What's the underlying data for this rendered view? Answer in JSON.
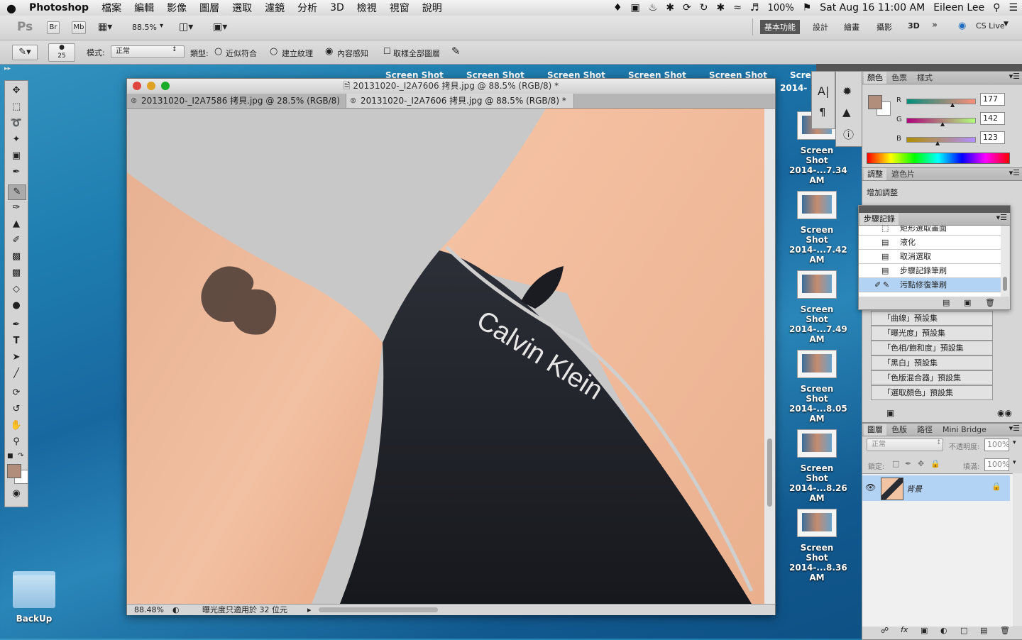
{
  "menubar": {
    "apple": "",
    "app": "Photoshop",
    "items": [
      "檔案",
      "編輯",
      "影像",
      "圖層",
      "選取",
      "濾鏡",
      "分析",
      "3D",
      "檢視",
      "視窗",
      "說明"
    ],
    "battery": "100%",
    "datetime": "Sat Aug 16  11:00 AM",
    "user": "Eileen Lee"
  },
  "appbar": {
    "ps": "Ps",
    "br": "Br",
    "mb": "Mb",
    "zoom": "88.5%",
    "workspaces": [
      "基本功能",
      "設計",
      "繪畫",
      "攝影",
      "3D"
    ],
    "active_workspace": "基本功能",
    "cslive": "CS Live"
  },
  "optbar": {
    "brush_size": "25",
    "mode_label": "模式:",
    "mode_value": "正常",
    "type_label": "類型:",
    "type_options": [
      "近似符合",
      "建立紋理",
      "內容感知"
    ],
    "selected_type": "內容感知",
    "sample_all": "取樣全部圖層"
  },
  "document": {
    "title": "20131020-_I2A7606 拷貝.jpg @ 88.5% (RGB/8) *",
    "tabs": [
      {
        "label": "20131020-_I2A7586 拷貝.jpg @ 28.5% (RGB/8)"
      },
      {
        "label": "20131020-_I2A7606 拷貝.jpg @ 88.5% (RGB/8) *"
      }
    ],
    "status_zoom": "88.48%",
    "status_text": "曝光度只適用於 32 位元",
    "canvas_text": "Calvin Klein"
  },
  "desktop": {
    "top_labels": [
      "Screen Shot",
      "Screen Shot",
      "Screen Shot",
      "Screen Shot",
      "Screen Shot",
      "Scree"
    ],
    "partial_label": "2014-",
    "icons": [
      {
        "line1": "Screen Shot",
        "line2": "2014-...7.34 AM"
      },
      {
        "line1": "Screen Shot",
        "line2": "2014-...7.42 AM"
      },
      {
        "line1": "Screen Shot",
        "line2": "2014-...7.49 AM"
      },
      {
        "line1": "Screen Shot",
        "line2": "2014-...8.05 AM"
      },
      {
        "line1": "Screen Shot",
        "line2": "2014-...8.26 AM"
      },
      {
        "line1": "Screen Shot",
        "line2": "2014-...8.36 AM"
      }
    ],
    "folder": "BackUp"
  },
  "color_panel": {
    "tabs": [
      "顏色",
      "色票",
      "樣式"
    ],
    "r_label": "R",
    "g_label": "G",
    "b_label": "B",
    "r": "177",
    "g": "142",
    "b": "123",
    "fg_color": "#b18e7b"
  },
  "adjust_panel": {
    "tabs": [
      "調整",
      "遮色片"
    ],
    "title": "增加調整",
    "presets": [
      "「曲線」預設集",
      "「曝光度」預設集",
      "「色相/飽和度」預設集",
      "「黑白」預設集",
      "「色版混合器」預設集",
      "「選取顏色」預設集"
    ]
  },
  "history_panel": {
    "tab": "步驟記錄",
    "items": [
      "矩形選取畫面",
      "液化",
      "取消選取",
      "步驟記錄筆刷",
      "污點修復筆刷"
    ]
  },
  "layers_panel": {
    "tabs": [
      "圖層",
      "色版",
      "路徑",
      "Mini Bridge"
    ],
    "blend": "正常",
    "opacity_label": "不透明度:",
    "opacity": "100%",
    "lock_label": "鎖定:",
    "fill_label": "填滿:",
    "fill": "100%",
    "layer_name": "背景"
  }
}
